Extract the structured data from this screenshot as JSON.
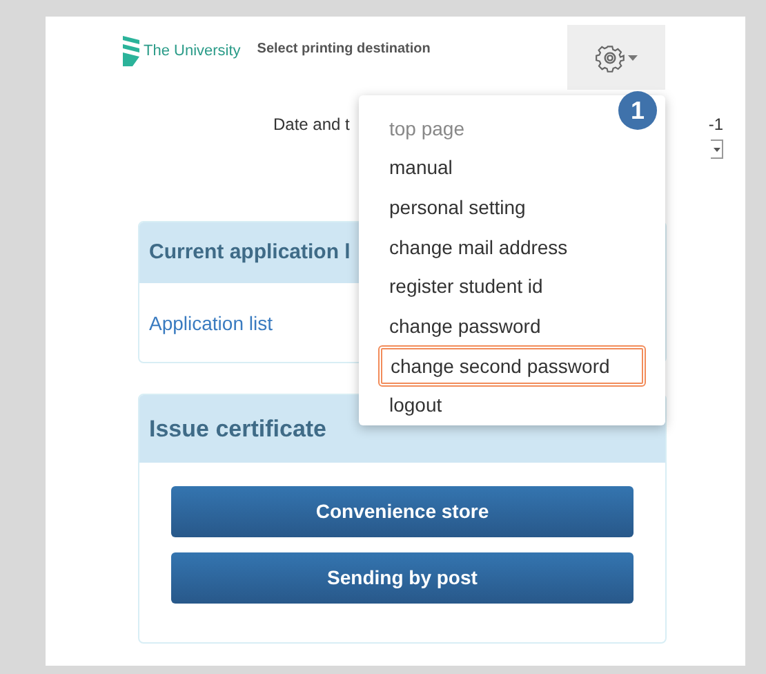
{
  "header": {
    "logo_text": "The University",
    "title": "Select printing destination"
  },
  "date_row": {
    "label": "Date and t",
    "value": "-1"
  },
  "menu": {
    "badge": "1",
    "items": [
      {
        "label": "top page",
        "disabled": true,
        "highlighted": false
      },
      {
        "label": "manual",
        "disabled": false,
        "highlighted": false
      },
      {
        "label": "personal setting",
        "disabled": false,
        "highlighted": false
      },
      {
        "label": "change mail address",
        "disabled": false,
        "highlighted": false
      },
      {
        "label": "register student id",
        "disabled": false,
        "highlighted": false
      },
      {
        "label": "change password",
        "disabled": false,
        "highlighted": false
      },
      {
        "label": "change second password",
        "disabled": false,
        "highlighted": true
      },
      {
        "label": "logout",
        "disabled": false,
        "highlighted": false
      }
    ]
  },
  "current_card": {
    "title": "Current application l",
    "link": "Application list"
  },
  "issue_card": {
    "title": "Issue certificate",
    "buttons": [
      "Convenience store",
      "Sending by post"
    ]
  }
}
